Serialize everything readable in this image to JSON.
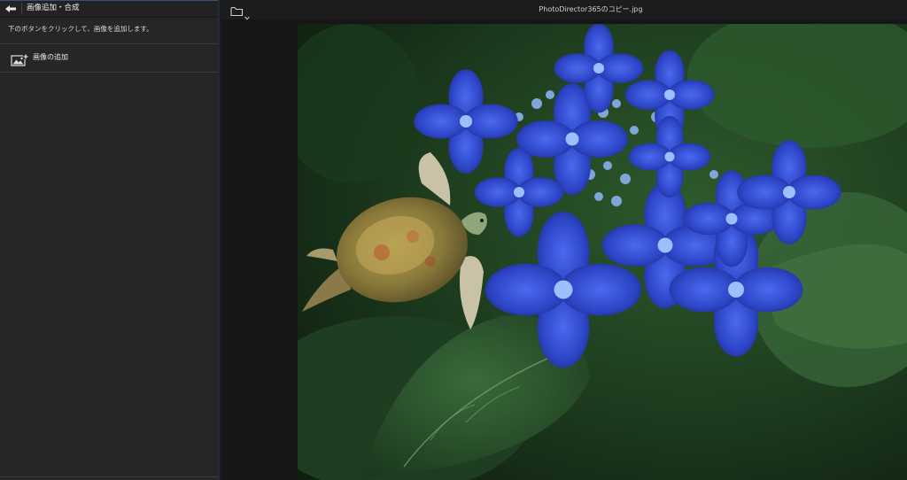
{
  "panel": {
    "title": "画像追加・合成",
    "instruction": "下のボタンをクリックして、画像を追加します。",
    "add_image_label": "画像の追加"
  },
  "topbar": {
    "file_name": "PhotoDirector365のコピー.jpg"
  },
  "icons": {
    "back": "back-arrow-icon",
    "add_image": "add-image-icon",
    "folder": "folder-icon",
    "chevron": "chevron-down-icon"
  },
  "colors": {
    "panel_bg": "#262626",
    "canvas_bg": "#161616",
    "accent": "#3a5270",
    "hydrangea_blue": "#2f49c8"
  }
}
